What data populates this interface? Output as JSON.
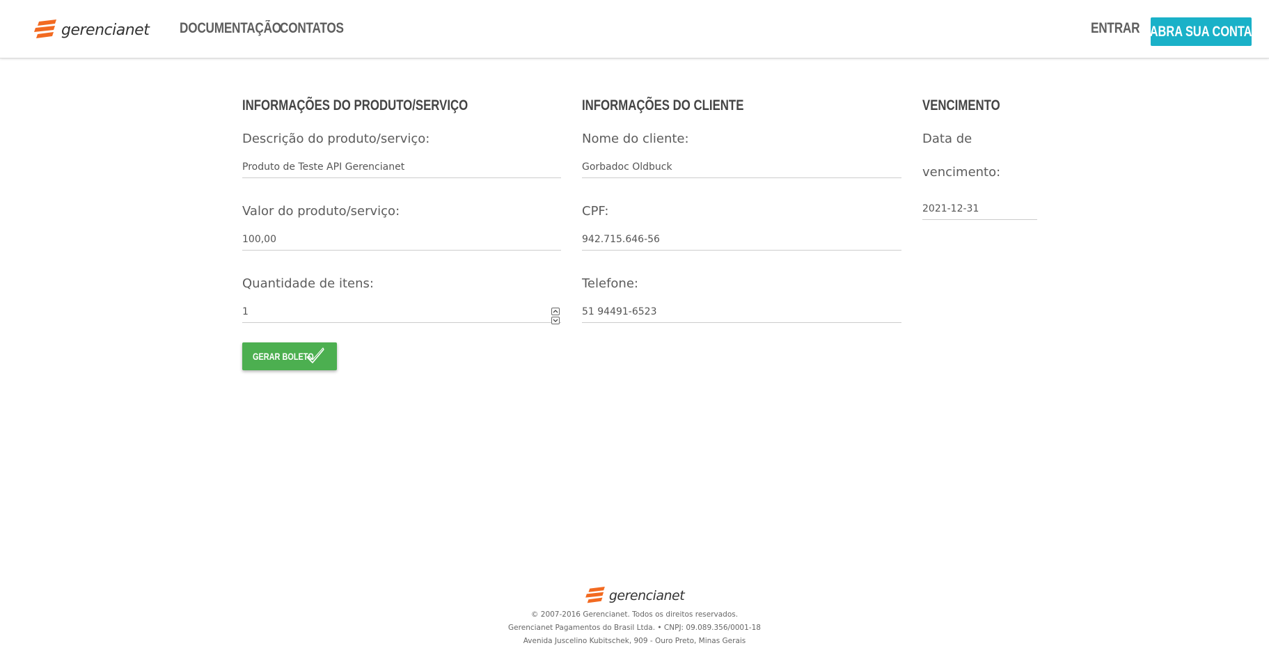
{
  "header": {
    "logo_text": "gerencianet",
    "nav": {
      "documentation": "DOCUMENTAÇÃO",
      "contacts": "CONTATOS",
      "login": "ENTRAR",
      "open_account": "ABRA SUA CONTA"
    }
  },
  "form": {
    "product": {
      "title": "INFORMAÇÕES DO PRODUTO/SERVIÇO",
      "description": {
        "label": "Descrição do produto/serviço:",
        "value": "Produto de Teste API Gerencianet"
      },
      "price": {
        "label": "Valor do produto/serviço:",
        "value": "100,00"
      },
      "quantity": {
        "label": "Quantidade de itens:",
        "value": "1"
      }
    },
    "client": {
      "title": "INFORMAÇÕES DO CLIENTE",
      "name": {
        "label": "Nome do cliente:",
        "value": "Gorbadoc Oldbuck"
      },
      "cpf": {
        "label": "CPF:",
        "value": "942.715.646-56"
      },
      "phone": {
        "label": "Telefone:",
        "value": "51 94491-6523"
      }
    },
    "due": {
      "title": "VENCIMENTO",
      "date": {
        "label": "Data de vencimento:",
        "value": "2021-12-31"
      }
    },
    "submit_label": "GERAR BOLETO"
  },
  "footer": {
    "logo_text": "gerencianet",
    "copyright": "© 2007-2016 Gerencianet. Todos os direitos reservados.",
    "company": "Gerencianet Pagamentos do Brasil Ltda. • CNPJ: 09.089.356/0001-18",
    "address": "Avenida Juscelino Kubitschek, 909 - Ouro Preto, Minas Gerais"
  },
  "colors": {
    "accent": "#1ab1c8",
    "submit": "#4caf50",
    "logo_orange": "#f26a21"
  },
  "icons": {
    "logo": "gerencianet-logo-icon",
    "submit": "check-icon",
    "stepper_up": "chevron-up-icon",
    "stepper_down": "chevron-down-icon"
  }
}
